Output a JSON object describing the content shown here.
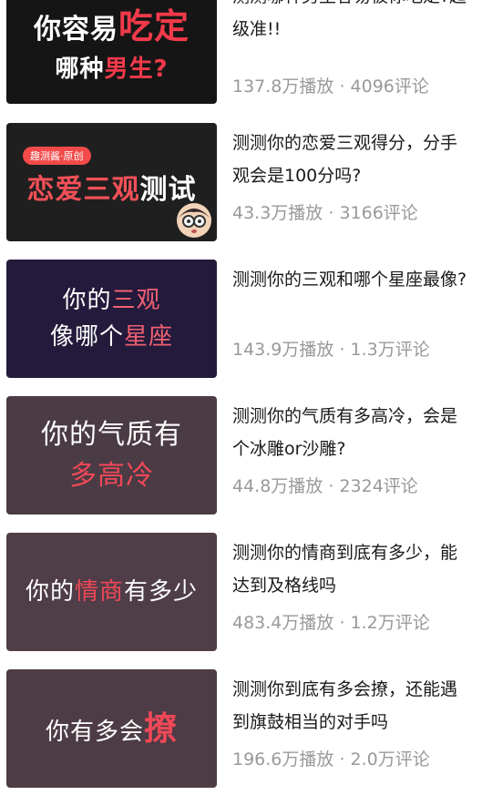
{
  "items": [
    {
      "thumb": {
        "line1": [
          "你容易",
          "吃定"
        ],
        "line2": [
          "哪种",
          "男生?"
        ]
      },
      "title": "测测哪种男生容易被你吃定?超级准!!",
      "views": "137.8万播放",
      "comments": "4096评论",
      "bg": "#151515"
    },
    {
      "thumb": {
        "badge": "趣测酱·原创",
        "line1": [
          "恋爱三观",
          "测试"
        ]
      },
      "title": "测测你的恋爱三观得分，分手观会是100分吗?",
      "views": "43.3万播放",
      "comments": "3166评论",
      "bg": "#1f1f1f"
    },
    {
      "thumb": {
        "line1": [
          "你的",
          "三观"
        ],
        "line2": [
          "像哪个",
          "星座"
        ]
      },
      "title": "测测你的三观和哪个星座最像?",
      "views": "143.9万播放",
      "comments": "1.3万评论",
      "bg": "#231a3c"
    },
    {
      "thumb": {
        "line1": [
          "你的气质有",
          ""
        ],
        "line2": [
          "",
          "多高冷"
        ]
      },
      "title": "测测你的气质有多高冷，会是个冰雕or沙雕?",
      "views": "44.8万播放",
      "comments": "2324评论",
      "bg": "#4a3b44"
    },
    {
      "thumb": {
        "line1": [
          "你的",
          "情商",
          "有多少"
        ]
      },
      "title": "测测你的情商到底有多少，能达到及格线吗",
      "views": "483.4万播放",
      "comments": "1.2万评论",
      "bg": "#4f3d47"
    },
    {
      "thumb": {
        "line1": [
          "你有多会",
          "撩"
        ]
      },
      "title": "测测你到底有多会撩，还能遇到旗鼓相当的对手吗",
      "views": "196.6万播放",
      "comments": "2.0万评论",
      "bg": "#4d3c45"
    }
  ],
  "separator": " · "
}
